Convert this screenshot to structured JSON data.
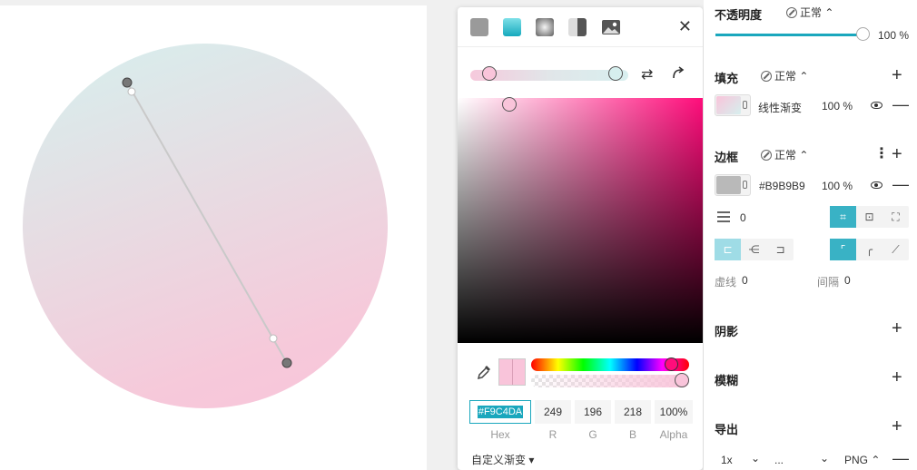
{
  "picker": {
    "fill_types": [
      {
        "name": "solid-fill-icon"
      },
      {
        "name": "linear-gradient-icon"
      },
      {
        "name": "radial-gradient-icon"
      },
      {
        "name": "angular-gradient-icon"
      },
      {
        "name": "image-fill-icon"
      }
    ],
    "close_icon": "close-icon",
    "values": {
      "hex": "#F9C4DA",
      "r": "249",
      "g": "196",
      "b": "218",
      "alpha": "100%"
    },
    "labels": {
      "hex": "Hex",
      "r": "R",
      "g": "G",
      "b": "B",
      "alpha": "Alpha"
    },
    "custom_gradient": "自定义渐变 ▾",
    "current_color": "#f9c4da"
  },
  "panel": {
    "opacity": {
      "title": "不透明度",
      "mode": "正常 ⌃",
      "value": "100 %",
      "level": 1.0
    },
    "fill": {
      "title": "填充",
      "mode": "正常 ⌃",
      "type_label": "线性渐变",
      "opacity": "100 %"
    },
    "border": {
      "title": "边框",
      "mode": "正常 ⌃",
      "color": "#B9B9B9",
      "opacity": "100 %",
      "width": "0",
      "dash_label": "虚线",
      "dash_value": "0",
      "gap_label": "间隔",
      "gap_value": "0"
    },
    "shadow": {
      "title": "阴影"
    },
    "blur": {
      "title": "模糊"
    },
    "export": {
      "title": "导出",
      "scale": "1x",
      "suffix": "...",
      "format": "PNG ⌃"
    }
  },
  "colors": {
    "accent": "#1aa7bd",
    "fill_start": "#f9c4da",
    "fill_end": "#d6efee",
    "border_swatch": "#b9b9b9"
  }
}
